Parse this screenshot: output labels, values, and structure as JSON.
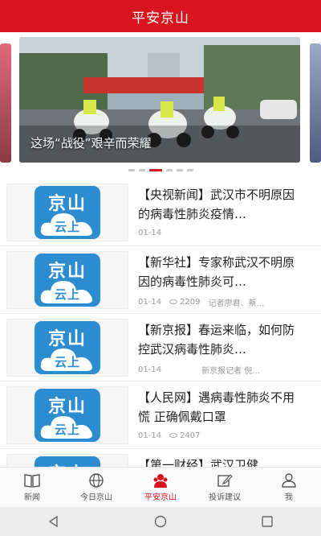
{
  "header": {
    "title": "平安京山"
  },
  "carousel": {
    "caption": "这场“战役”艰辛而荣耀",
    "dot_count": 6,
    "active_dot": 2
  },
  "news": [
    {
      "title": "【央视新闻】武汉市不明原因的病毒性肺炎疫情…",
      "date": "01-14",
      "views": "",
      "author": ""
    },
    {
      "title": "【新华社】专家称武汉不明原因的病毒性肺炎可…",
      "date": "01-14",
      "views": "2209",
      "author": "记者廖君、蔡…"
    },
    {
      "title": "【新京报】春运来临，如何防控武汉病毒性肺炎…",
      "date": "01-14",
      "views": "",
      "author": "新京报记者 倪…"
    },
    {
      "title": "【人民网】遇病毒性肺炎不用慌 正确佩戴口罩",
      "date": "01-14",
      "views": "2407",
      "author": ""
    },
    {
      "title": "【第一财经】武汉卫健",
      "date": "",
      "views": "",
      "author": ""
    }
  ],
  "logo": {
    "top": "京山",
    "bottom": "云上"
  },
  "tabbar": {
    "items": [
      {
        "label": "新闻",
        "icon": "book-icon"
      },
      {
        "label": "今日京山",
        "icon": "globe-icon"
      },
      {
        "label": "平安京山",
        "icon": "police-icon",
        "active": true
      },
      {
        "label": "投诉建议",
        "icon": "edit-icon"
      },
      {
        "label": "我",
        "icon": "person-icon"
      }
    ]
  },
  "colors": {
    "brand": "#d8141e",
    "logo_blue": "#2c8cd0"
  }
}
